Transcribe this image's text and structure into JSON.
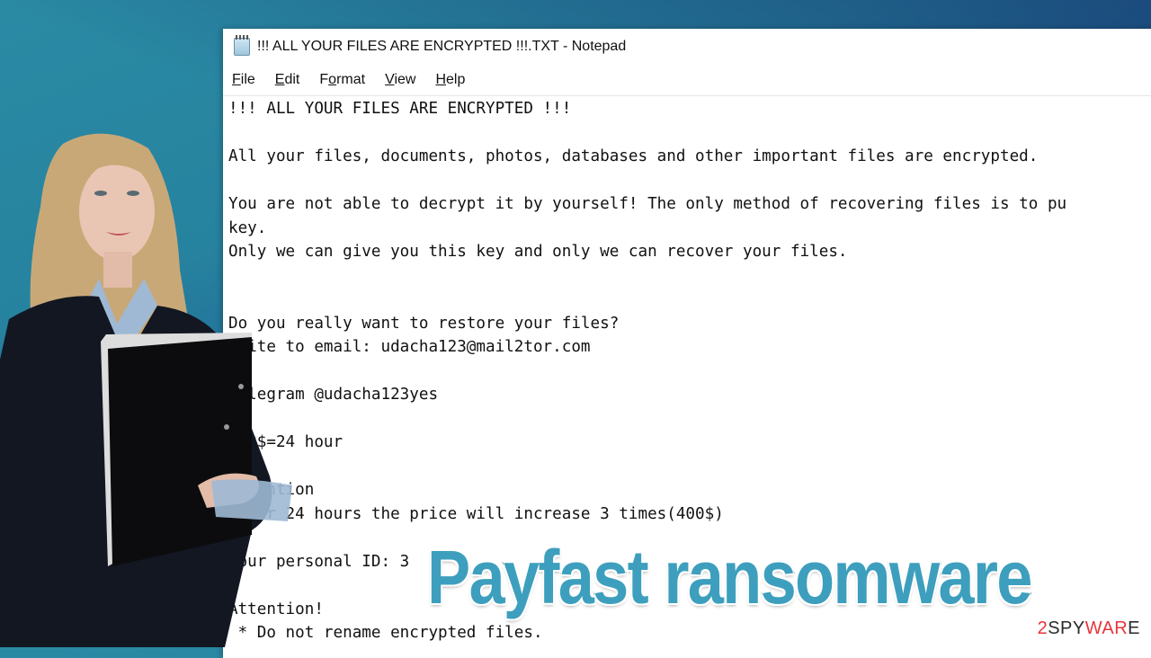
{
  "window": {
    "title": "!!! ALL YOUR FILES ARE ENCRYPTED !!!.TXT - Notepad",
    "app_icon": "notepad-icon"
  },
  "menu": [
    {
      "label": "File",
      "accel": "F"
    },
    {
      "label": "Edit",
      "accel": "E"
    },
    {
      "label": "Format",
      "accel": "o"
    },
    {
      "label": "View",
      "accel": "V"
    },
    {
      "label": "Help",
      "accel": "H"
    }
  ],
  "document": {
    "lines": [
      "!!! ALL YOUR FILES ARE ENCRYPTED !!!",
      "",
      "All your files, documents, photos, databases and other important files are encrypted.",
      "",
      "You are not able to decrypt it by yourself! The only method of recovering files is to pu",
      "key.",
      "Only we can give you this key and only we can recover your files.",
      "",
      "",
      "Do you really want to restore your files?",
      "Write to email: udacha123@mail2tor.com",
      "",
      "Telegram @udacha123yes",
      "",
      "100$=24 hour",
      "",
      "Attention",
      "After 24 hours the price will increase 3 times(400$)",
      "",
      "Your personal ID: 3",
      "",
      "Attention!",
      " * Do not rename encrypted files."
    ]
  },
  "overlay": {
    "headline": "Payfast ransomware",
    "brand_prefix": "2",
    "brand_spy": "SPY",
    "brand_ware": "WAR",
    "brand_suffix": "E"
  },
  "colors": {
    "headline": "#3d9fbd",
    "brand_red": "#e8343c",
    "background_teal": "#2a8aa4",
    "background_blue": "#17306f"
  }
}
